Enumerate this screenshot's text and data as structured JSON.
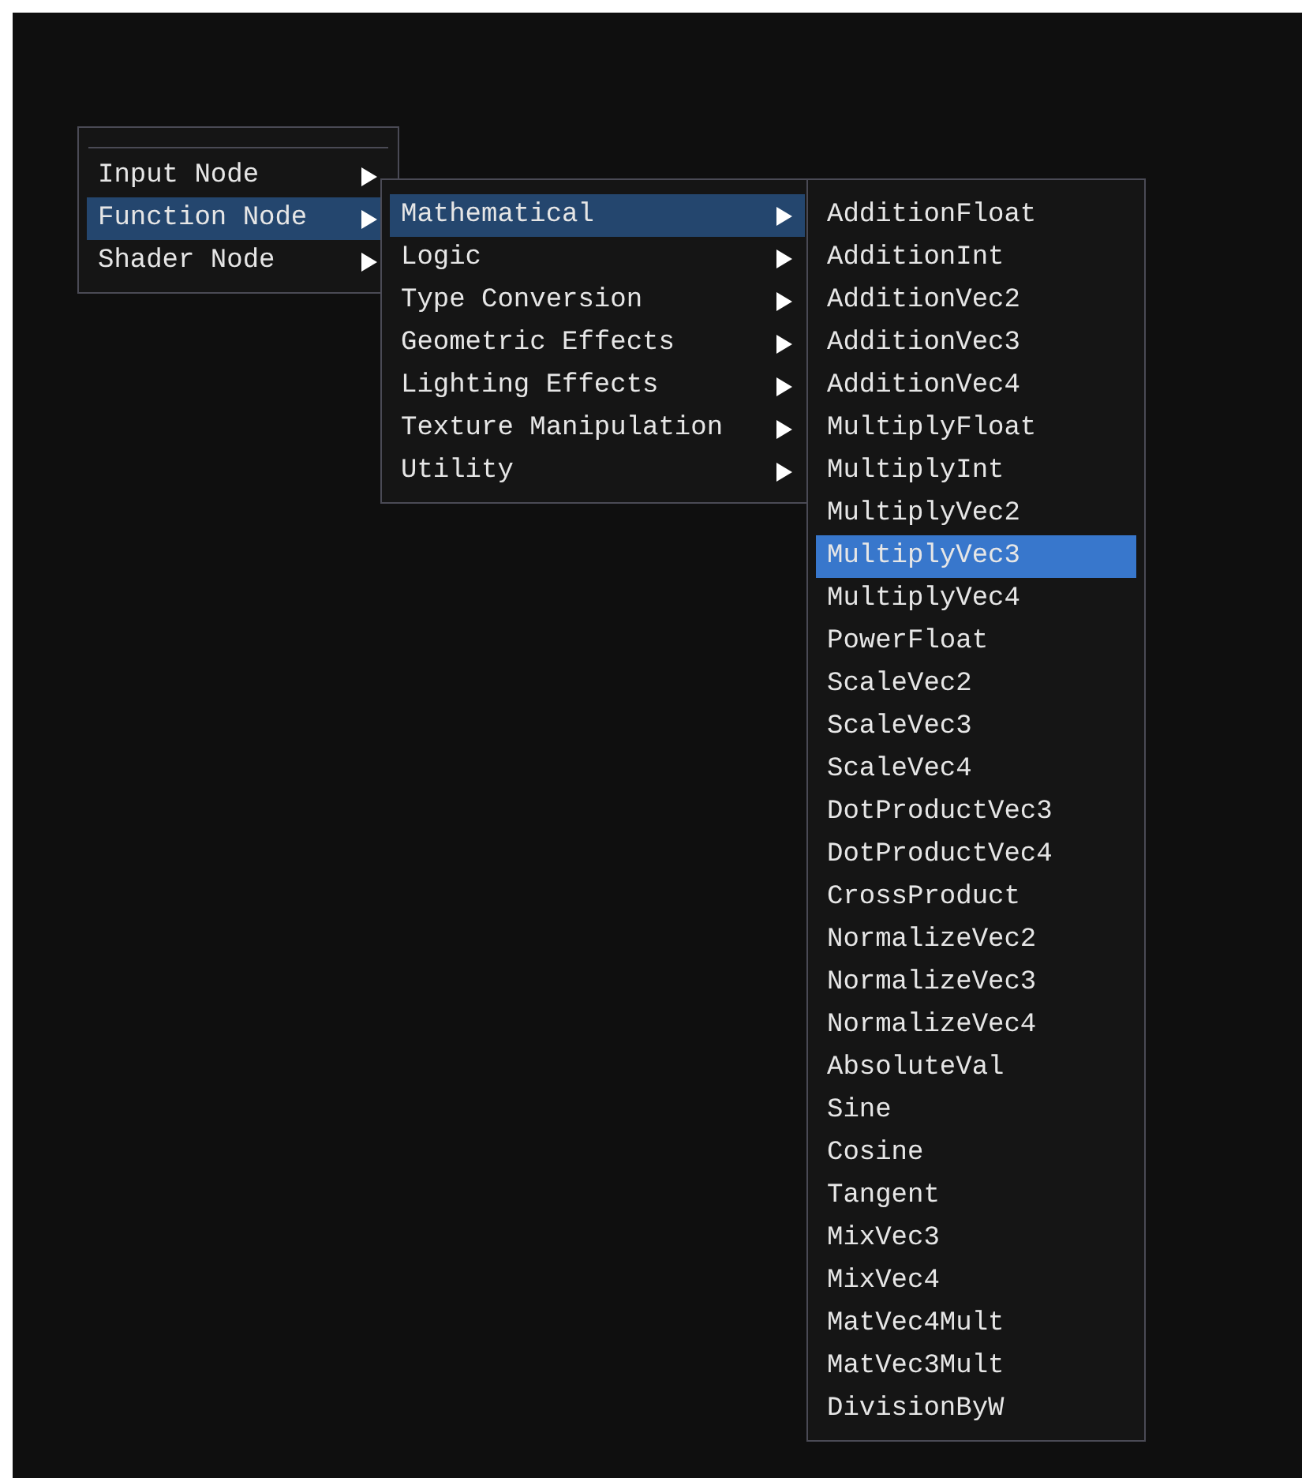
{
  "menus": [
    {
      "separator_top": true,
      "items": [
        {
          "label": "Input Node",
          "submenu": true,
          "selected": false
        },
        {
          "label": "Function Node",
          "submenu": true,
          "selected": true
        },
        {
          "label": "Shader Node",
          "submenu": true,
          "selected": false
        }
      ]
    },
    {
      "separator_top": false,
      "items": [
        {
          "label": "Mathematical",
          "submenu": true,
          "selected": true
        },
        {
          "label": "Logic",
          "submenu": true,
          "selected": false
        },
        {
          "label": "Type Conversion",
          "submenu": true,
          "selected": false
        },
        {
          "label": "Geometric Effects",
          "submenu": true,
          "selected": false
        },
        {
          "label": "Lighting Effects",
          "submenu": true,
          "selected": false
        },
        {
          "label": "Texture Manipulation",
          "submenu": true,
          "selected": false
        },
        {
          "label": "Utility",
          "submenu": true,
          "selected": false
        }
      ]
    },
    {
      "separator_top": false,
      "items": [
        {
          "label": "AdditionFloat",
          "submenu": false,
          "selected": false
        },
        {
          "label": "AdditionInt",
          "submenu": false,
          "selected": false
        },
        {
          "label": "AdditionVec2",
          "submenu": false,
          "selected": false
        },
        {
          "label": "AdditionVec3",
          "submenu": false,
          "selected": false
        },
        {
          "label": "AdditionVec4",
          "submenu": false,
          "selected": false
        },
        {
          "label": "MultiplyFloat",
          "submenu": false,
          "selected": false
        },
        {
          "label": "MultiplyInt",
          "submenu": false,
          "selected": false
        },
        {
          "label": "MultiplyVec2",
          "submenu": false,
          "selected": false
        },
        {
          "label": "MultiplyVec3",
          "submenu": false,
          "selected": true
        },
        {
          "label": "MultiplyVec4",
          "submenu": false,
          "selected": false
        },
        {
          "label": "PowerFloat",
          "submenu": false,
          "selected": false
        },
        {
          "label": "ScaleVec2",
          "submenu": false,
          "selected": false
        },
        {
          "label": "ScaleVec3",
          "submenu": false,
          "selected": false
        },
        {
          "label": "ScaleVec4",
          "submenu": false,
          "selected": false
        },
        {
          "label": "DotProductVec3",
          "submenu": false,
          "selected": false
        },
        {
          "label": "DotProductVec4",
          "submenu": false,
          "selected": false
        },
        {
          "label": "CrossProduct",
          "submenu": false,
          "selected": false
        },
        {
          "label": "NormalizeVec2",
          "submenu": false,
          "selected": false
        },
        {
          "label": "NormalizeVec3",
          "submenu": false,
          "selected": false
        },
        {
          "label": "NormalizeVec4",
          "submenu": false,
          "selected": false
        },
        {
          "label": "AbsoluteVal",
          "submenu": false,
          "selected": false
        },
        {
          "label": "Sine",
          "submenu": false,
          "selected": false
        },
        {
          "label": "Cosine",
          "submenu": false,
          "selected": false
        },
        {
          "label": "Tangent",
          "submenu": false,
          "selected": false
        },
        {
          "label": "MixVec3",
          "submenu": false,
          "selected": false
        },
        {
          "label": "MixVec4",
          "submenu": false,
          "selected": false
        },
        {
          "label": "MatVec4Mult",
          "submenu": false,
          "selected": false
        },
        {
          "label": "MatVec3Mult",
          "submenu": false,
          "selected": false
        },
        {
          "label": "DivisionByW",
          "submenu": false,
          "selected": false
        }
      ]
    }
  ]
}
